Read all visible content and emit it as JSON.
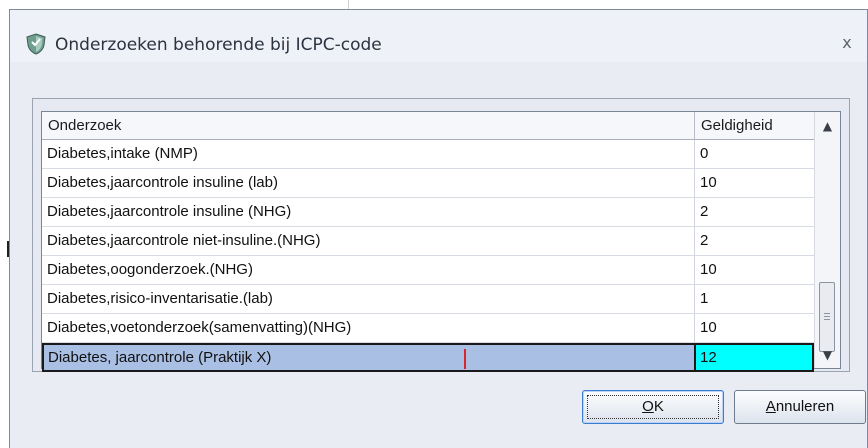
{
  "dialog": {
    "title": "Onderzoeken behorende bij ICPC-code",
    "close_glyph": "x"
  },
  "grid": {
    "columns": [
      "Onderzoek",
      "Geldigheid"
    ],
    "rows": [
      {
        "onderzoek": "Diabetes,intake (NMP)",
        "geldigheid": "0"
      },
      {
        "onderzoek": "Diabetes,jaarcontrole insuline (lab)",
        "geldigheid": "10"
      },
      {
        "onderzoek": "Diabetes,jaarcontrole insuline (NHG)",
        "geldigheid": "2"
      },
      {
        "onderzoek": "Diabetes,jaarcontrole niet-insuline.(NHG)",
        "geldigheid": "2"
      },
      {
        "onderzoek": "Diabetes,oogonderzoek.(NHG)",
        "geldigheid": "10"
      },
      {
        "onderzoek": "Diabetes,risico-inventarisatie.(lab)",
        "geldigheid": "1"
      },
      {
        "onderzoek": "Diabetes,voetonderzoek(samenvatting)(NHG)",
        "geldigheid": "10"
      },
      {
        "onderzoek": "Diabetes, jaarcontrole (Praktijk X)",
        "geldigheid": "12",
        "selected": true
      }
    ],
    "scroll_up_glyph": "▲",
    "scroll_down_glyph": "▼"
  },
  "buttons": {
    "ok": {
      "mnemonic": "O",
      "rest": "K"
    },
    "cancel": {
      "mnemonic": "A",
      "rest": "nnuleren"
    }
  },
  "colors": {
    "selected_value_cell": "#00ffff",
    "selected_name_cell": "#a9bfe4",
    "edit_caret": "#d9262c",
    "title_icon": "#6f9e8f"
  },
  "icons": {
    "title": "shield-icon",
    "close": "close-icon",
    "scroll_up": "arrow-up-icon",
    "scroll_down": "arrow-down-icon"
  }
}
